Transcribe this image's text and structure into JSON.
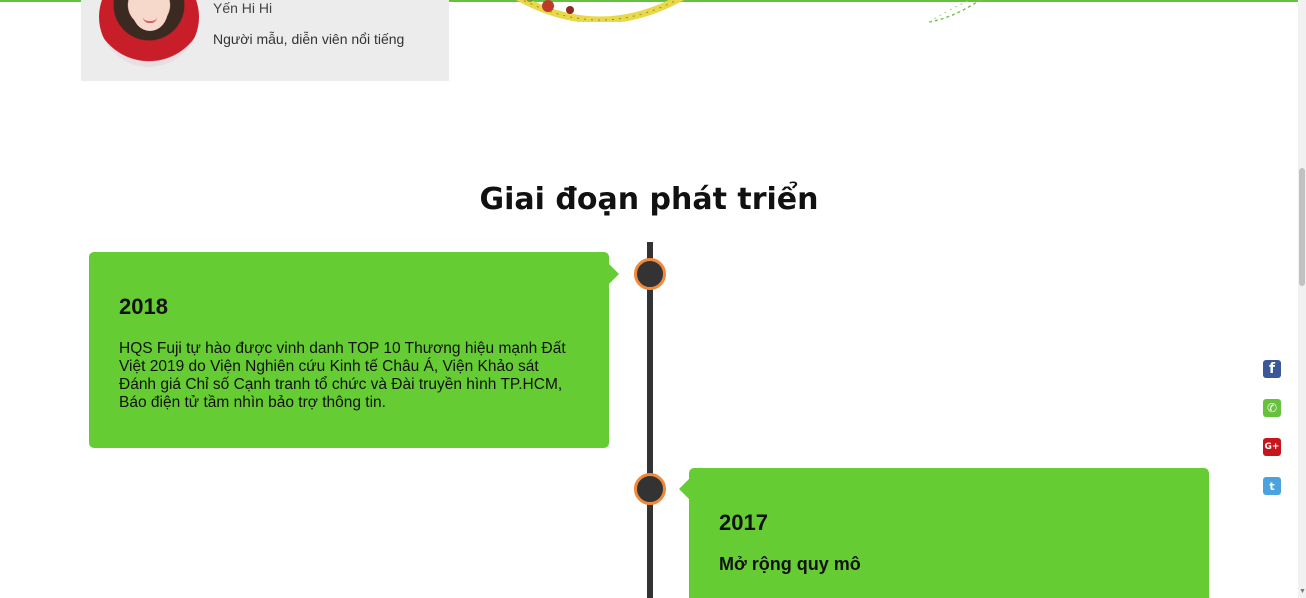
{
  "testimonial": {
    "name": "Yến Hi Hi",
    "role": "Người mẫu, diễn viên nổi tiếng"
  },
  "section": {
    "title": "Giai đoạn phát triển"
  },
  "timeline": [
    {
      "year": "2018",
      "text": "HQS Fuji tự hào được vinh danh TOP 10 Thương hiệu mạnh Đất Việt 2019 do Viện Nghiên cứu Kinh tế Châu Á, Viện Khảo sát Đánh giá Chỉ số Cạnh tranh tổ chức và Đài truyền hình TP.HCM, Báo điện tử tầm nhìn bảo trợ thông tin."
    },
    {
      "year": "2017",
      "subtitle": "Mở rộng quy mô"
    }
  ],
  "social": {
    "facebook": "f",
    "phone": "✆",
    "gplus": "G+",
    "twitter": "t"
  },
  "colors": {
    "accent_green": "#66cc33",
    "dot_ring": "#f0893a",
    "timeline": "#333333",
    "facebook": "#3b5998",
    "gplus": "#c4161c",
    "twitter": "#4aa3df"
  },
  "icons": [
    "facebook-icon",
    "phone-icon",
    "google-plus-icon",
    "twitter-icon"
  ]
}
